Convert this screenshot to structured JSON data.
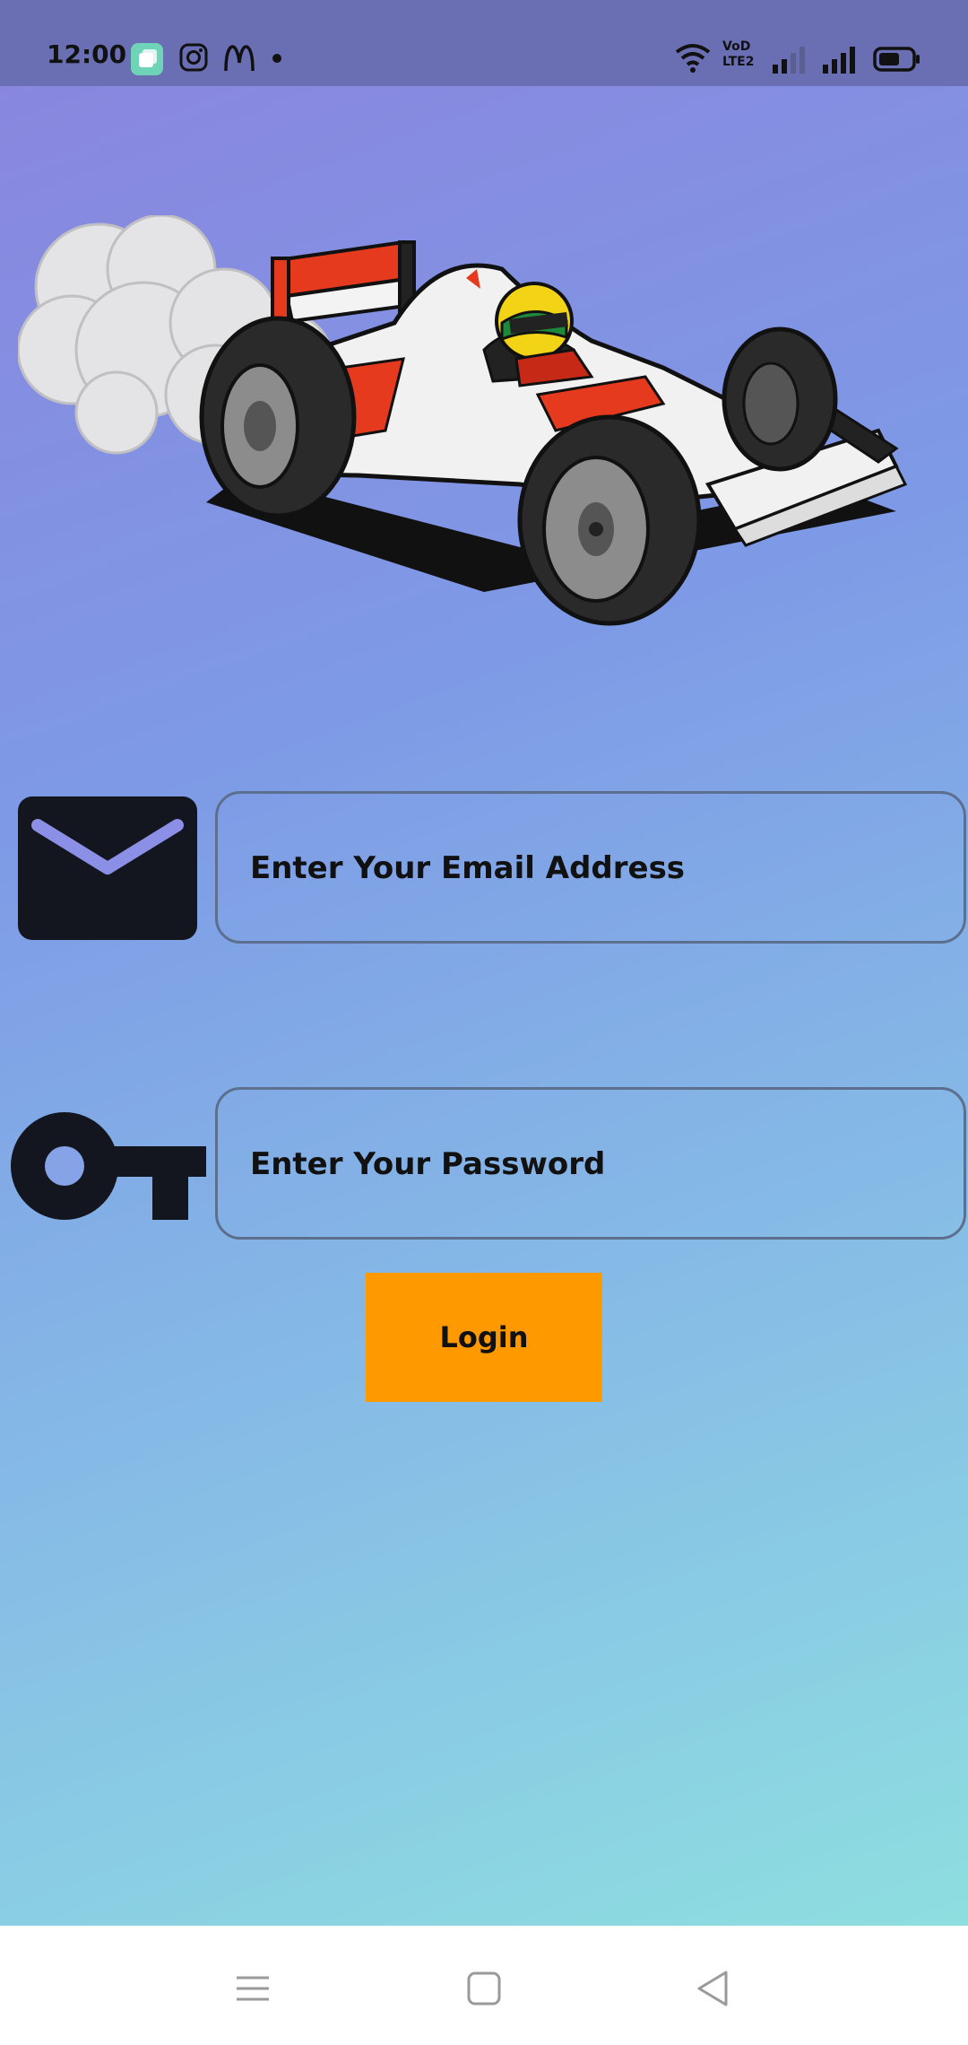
{
  "status_bar": {
    "time": "12:00",
    "icons": [
      "app-notification-icon",
      "instagram-icon",
      "mcdonalds-icon",
      "dot-icon",
      "wifi-icon",
      "volte-icon",
      "signal-icon",
      "signal-icon",
      "battery-icon"
    ],
    "volte_label": "VoD LTE2"
  },
  "hero": {
    "image": "race-car-illustration"
  },
  "form": {
    "email": {
      "icon": "envelope-icon",
      "placeholder": "Enter Your Email Address"
    },
    "password": {
      "icon": "key-icon",
      "placeholder": "Enter Your Password"
    },
    "login_label": "Login"
  },
  "nav_bar": {
    "buttons": [
      "menu-icon",
      "home-icon",
      "back-icon"
    ]
  },
  "colors": {
    "accent_button": "#ff9900",
    "icon_dark": "#14161f",
    "status_bar": "#6a6fb4"
  }
}
